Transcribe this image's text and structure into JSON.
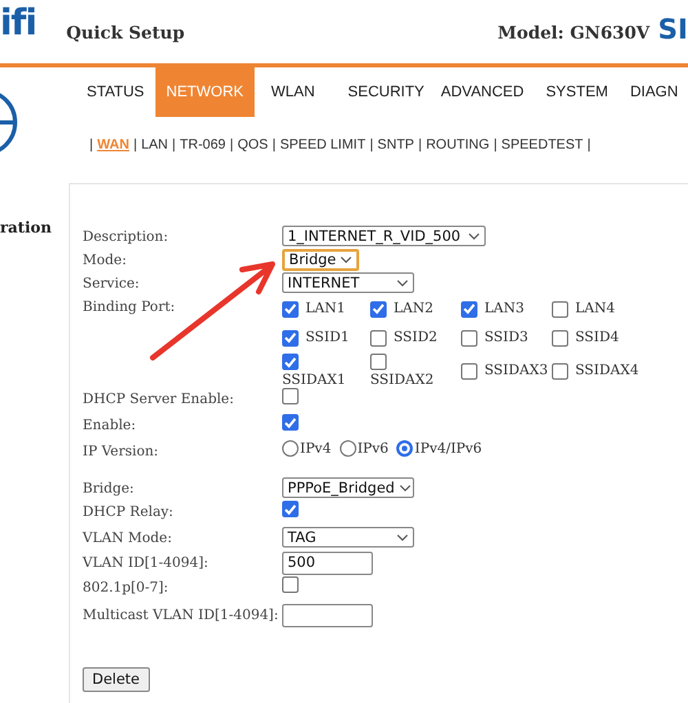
{
  "header": {
    "logo": "ifi",
    "title": "Quick Setup",
    "model": "Model: GN630V",
    "brand": "SI"
  },
  "nav": [
    {
      "label": "STATUS",
      "selected": false
    },
    {
      "label": "NETWORK",
      "selected": true
    },
    {
      "label": "WLAN",
      "selected": false
    },
    {
      "label": "SECURITY",
      "selected": false
    },
    {
      "label": "ADVANCED",
      "selected": false
    },
    {
      "label": "SYSTEM",
      "selected": false
    },
    {
      "label": "DIAGN",
      "selected": false
    }
  ],
  "subnav_separator": "|",
  "subnav": [
    {
      "label": "WAN",
      "selected": true
    },
    {
      "label": "LAN",
      "selected": false
    },
    {
      "label": "TR-069",
      "selected": false
    },
    {
      "label": "QOS",
      "selected": false
    },
    {
      "label": "SPEED LIMIT",
      "selected": false
    },
    {
      "label": "SNTP",
      "selected": false
    },
    {
      "label": "ROUTING",
      "selected": false
    },
    {
      "label": "SPEEDTEST",
      "selected": false
    }
  ],
  "sidebar": {
    "heading": "ration"
  },
  "form": [
    {
      "kind": "select",
      "label": "Description:",
      "value": "1_INTERNET_R_VID_500",
      "focused": false
    },
    {
      "kind": "select",
      "label": "Mode:",
      "value": "Bridge",
      "focused": true
    },
    {
      "kind": "select",
      "label": "Service:",
      "value": "INTERNET",
      "focused": false
    },
    {
      "kind": "ports",
      "label": "Binding Port:",
      "ports": [
        {
          "label": "LAN1",
          "checked": true,
          "label_below": false
        },
        {
          "label": "LAN2",
          "checked": true,
          "label_below": false
        },
        {
          "label": "LAN3",
          "checked": true,
          "label_below": false
        },
        {
          "label": "LAN4",
          "checked": false,
          "label_below": false
        },
        {
          "label": "SSID1",
          "checked": true,
          "label_below": false
        },
        {
          "label": "SSID2",
          "checked": false,
          "label_below": false
        },
        {
          "label": "SSID3",
          "checked": false,
          "label_below": false
        },
        {
          "label": "SSID4",
          "checked": false,
          "label_below": false
        },
        {
          "label": "SSIDAX1",
          "checked": true,
          "label_below": true
        },
        {
          "label": "SSIDAX2",
          "checked": false,
          "label_below": true
        },
        {
          "label": "SSIDAX3",
          "checked": false,
          "label_below": false
        },
        {
          "label": "SSIDAX4",
          "checked": false,
          "label_below": false
        }
      ]
    },
    {
      "kind": "checkbox",
      "label": "DHCP Server Enable:",
      "checked": false
    },
    {
      "kind": "checkbox",
      "label": "Enable:",
      "checked": true
    },
    {
      "kind": "radio",
      "label": "IP Version:",
      "options": [
        {
          "label": "IPv4",
          "selected": false
        },
        {
          "label": "IPv6",
          "selected": false
        },
        {
          "label": "IPv4/IPv6",
          "selected": true
        }
      ]
    },
    {
      "kind": "select",
      "label": "Bridge:",
      "value": "PPPoE_Bridged",
      "focused": false
    },
    {
      "kind": "checkbox",
      "label": "DHCP Relay:",
      "checked": true
    },
    {
      "kind": "select",
      "label": "VLAN Mode:",
      "value": "TAG",
      "focused": false
    },
    {
      "kind": "text",
      "label": "VLAN ID[1-4094]:",
      "value": "500"
    },
    {
      "kind": "checkbox",
      "label": "802.1p[0-7]:",
      "checked": false
    },
    {
      "kind": "text",
      "label": "Multicast VLAN ID[1-4094]:"
    }
  ],
  "buttons": [
    {
      "label": "Delete"
    }
  ]
}
